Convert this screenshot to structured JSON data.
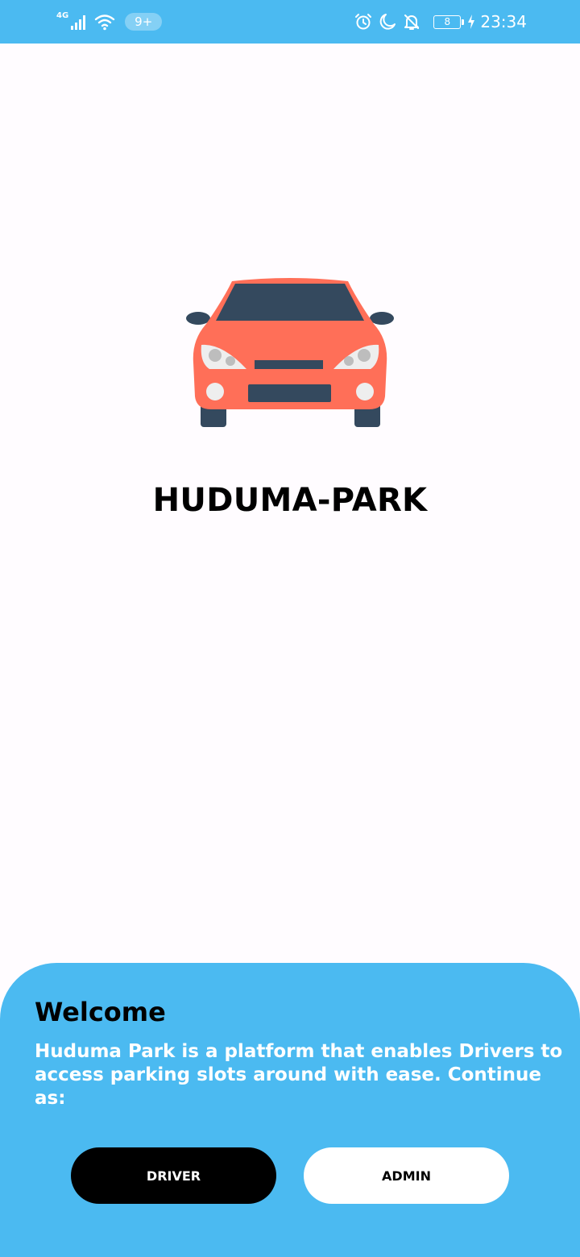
{
  "status_bar": {
    "network": "4G",
    "notification_count": "9+",
    "battery_level": "8",
    "time": "23:34",
    "background_color": "#4bbaf1"
  },
  "app": {
    "title": "HUDUMA-PARK",
    "logo_icon": "car-icon"
  },
  "welcome": {
    "title": "Welcome",
    "message": "Huduma Park is a platform that enables Drivers to access parking slots around with ease. Continue as:",
    "background_color": "#4bbaf1"
  },
  "buttons": {
    "driver_label": "DRIVER",
    "admin_label": "ADMIN"
  }
}
